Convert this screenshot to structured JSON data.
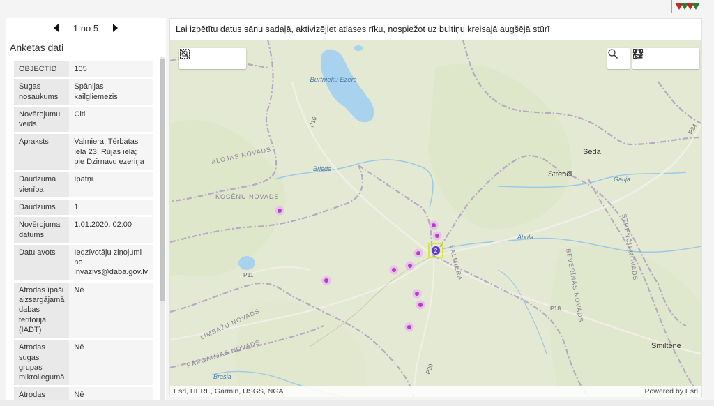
{
  "pager": {
    "label": "1 no 5"
  },
  "panel": {
    "title": "Anketas dati",
    "rows": [
      {
        "key": "OBJECTID",
        "value": "105"
      },
      {
        "key": "Sugas nosaukums",
        "value": "Spānijas kailgliemezis"
      },
      {
        "key": "Novērojumu veids",
        "value": "Citi"
      },
      {
        "key": "Apraksts",
        "value": "Valmiera, Tērbatas iela 23; Rūjas iela; pie Dzirnavu ezeriņa"
      },
      {
        "key": "Daudzuma vienība",
        "value": "īpatņi"
      },
      {
        "key": "Daudzums",
        "value": "1"
      },
      {
        "key": "Novērojuma datums",
        "value": "1.01.2020. 02:00"
      },
      {
        "key": "Datu avots",
        "value": "Iedzīvotāju ziņojumi no invazivs@daba.gov.lv"
      },
      {
        "key": "Atrodas īpaši aizsargājamā dabas teritorijā (ĪADT)",
        "value": "Nē"
      },
      {
        "key": "Atrodas sugas grupas mikroliegumā",
        "value": "Nē"
      },
      {
        "key": "Atrodas aizsargājamā biotopā",
        "value": "Nē"
      }
    ]
  },
  "map": {
    "header": "Lai izpētītu datus sānu sadaļā, aktivizējiet atlases rīku, nospiežot uz bultiņu kreisajā augšējā stūrī",
    "attribution": "Esri, HERE, Garmin, USGS, NGA",
    "powered": "Powered by Esri",
    "labels": {
      "lake": "Burtnieku Ezers",
      "alojas": "ALOJAS NOVADS",
      "kocenu": "KOCĒNU NOVADS",
      "limbazu": "LIMBAŽU NOVADS",
      "pargaujas": "PĀRGAUJAS NOVADS",
      "beverinas": "BEVERĪNAS NOVADS",
      "strencu": "STRENČU NOVADS",
      "valmiera": "VALMIERA",
      "seda": "Seda",
      "strenci": "Strenči",
      "smiltene": "Smiltene",
      "briede": "Briede",
      "abula": "Abula",
      "gauja": "Gauja",
      "brasla": "Brasla",
      "p16": "P16",
      "p11": "P11",
      "p18": "P18",
      "p20": "P20",
      "p24": "P24"
    },
    "selected_count": "2",
    "colors": {
      "point": "#b23fc9",
      "point_glow": "#e9b7f0",
      "selection": "#d6e63a",
      "boundary": "#b7a9c4",
      "water": "#a9d2ee"
    }
  },
  "icons": [
    "chevron-left-icon",
    "chevron-right-icon",
    "select-rectangle-icon",
    "select-by-layer-icon",
    "close-icon",
    "search-icon",
    "home-icon",
    "layers-icon",
    "qr-code-icon"
  ]
}
